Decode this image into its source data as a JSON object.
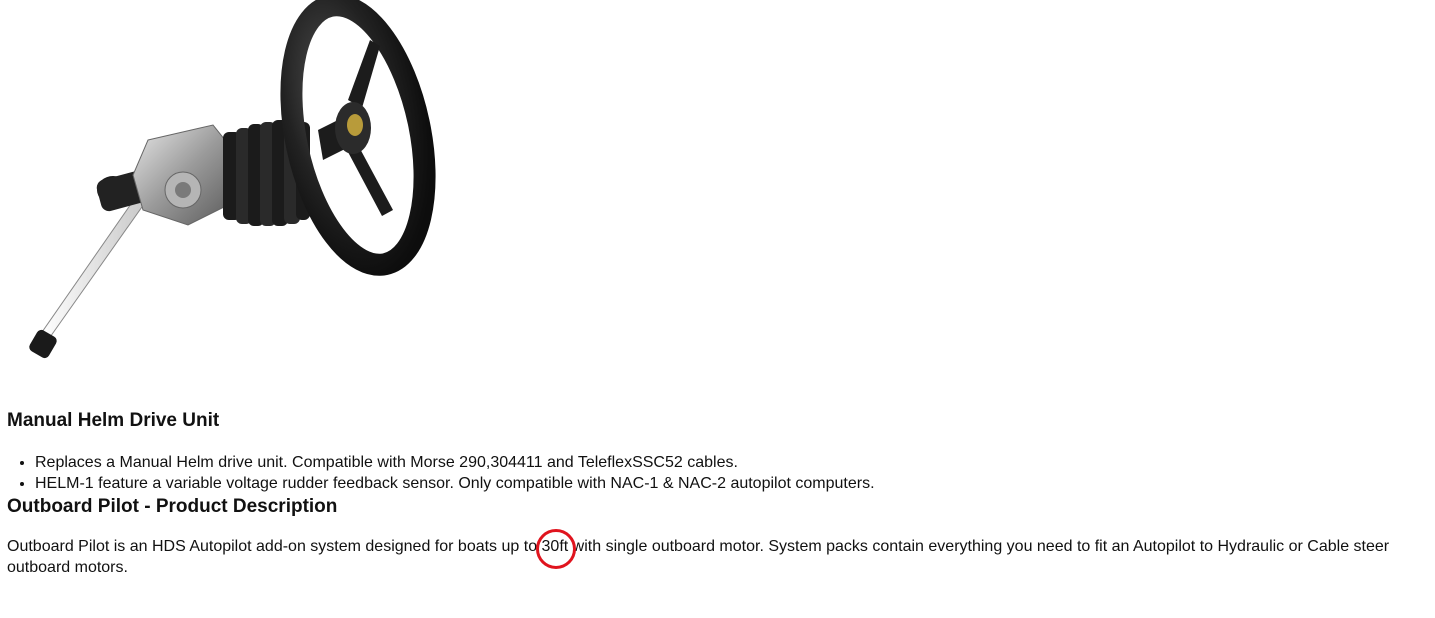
{
  "product": {
    "image_alt": "steering-wheel-helm-drive-unit",
    "title": "Manual Helm Drive Unit",
    "features": [
      "Replaces a Manual Helm drive unit. Compatible with Morse 290,304411 and TeleflexSSC52 cables.",
      "HELM-1 feature a variable voltage rudder feedback sensor. Only compatible with NAC-1 & NAC-2 autopilot computers."
    ]
  },
  "description": {
    "heading": "Outboard Pilot - Product Description",
    "text_before": "Outboard Pilot is an HDS Autopilot add-on system designed for boats up to ",
    "highlight": "30ft",
    "text_after": " with single outboard motor. System packs contain everything you need to fit an Autopilot to Hydraulic or Cable steer outboard motors.",
    "highlight_color": "#e0141e"
  }
}
